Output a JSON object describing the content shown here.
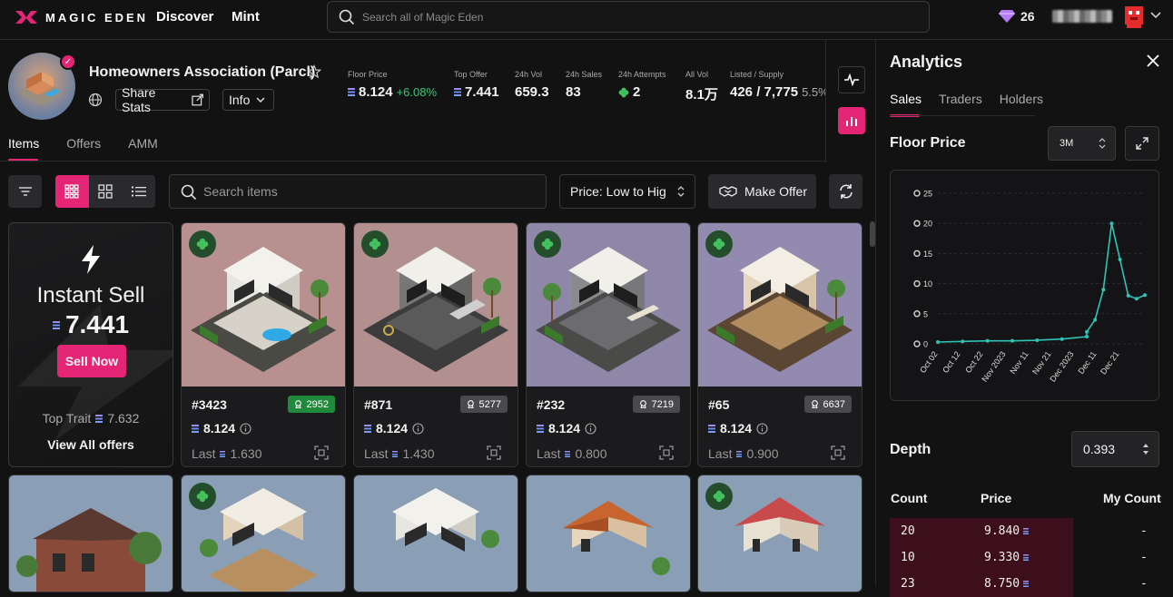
{
  "topbar": {
    "brand": "MAGIC EDEN",
    "nav": [
      "Discover",
      "Mint"
    ],
    "search_placeholder": "Search all of Magic Eden",
    "gem_count": "26"
  },
  "collection": {
    "name": "Homeowners Association (Parcl)",
    "share_label": "Share Stats",
    "info_label": "Info",
    "stats": [
      {
        "label": "Floor Price",
        "value": "8.124",
        "change": "+6.08%",
        "sol": true
      },
      {
        "label": "Top Offer",
        "value": "7.441",
        "sol": true
      },
      {
        "label": "24h Vol",
        "value": "659.3"
      },
      {
        "label": "24h Sales",
        "value": "83"
      },
      {
        "label": "24h Attempts",
        "value": "2",
        "clover": true
      },
      {
        "label": "All Vol",
        "value": "8.1万"
      },
      {
        "label": "Listed / Supply",
        "value": "426 / 7,775",
        "extra": "5.5%"
      }
    ]
  },
  "tabs": [
    "Items",
    "Offers",
    "AMM"
  ],
  "toolbar": {
    "search_placeholder": "Search items",
    "sort_label": "Price: Low to Hig",
    "make_offer_label": "Make Offer"
  },
  "instant_sell": {
    "title": "Instant Sell",
    "price": "7.441",
    "button": "Sell Now",
    "top_trait_label": "Top Trait",
    "top_trait_value": "7.632",
    "view_all": "View All offers"
  },
  "items": [
    {
      "id": "#3423",
      "rank": "2952",
      "rank_color": "green",
      "price": "8.124",
      "last": "1.630",
      "bg": "#b89090"
    },
    {
      "id": "#871",
      "rank": "5277",
      "rank_color": "grey",
      "price": "8.124",
      "last": "1.430",
      "bg": "#b39090"
    },
    {
      "id": "#232",
      "rank": "7219",
      "rank_color": "grey",
      "price": "8.124",
      "last": "0.800",
      "bg": "#8f87a8"
    },
    {
      "id": "#65",
      "rank": "6637",
      "rank_color": "grey",
      "price": "8.124",
      "last": "0.900",
      "bg": "#938ab0"
    }
  ],
  "last_label": "Last",
  "analytics": {
    "title": "Analytics",
    "tabs": [
      "Sales",
      "Traders",
      "Holders"
    ],
    "floor_title": "Floor Price",
    "range": "3M",
    "depth_title": "Depth",
    "depth_value": "0.393",
    "depth_headers": [
      "Count",
      "Price",
      "My Count"
    ],
    "depth_rows": [
      {
        "count": "20",
        "price": "9.840",
        "my": "-",
        "fill": 0.68
      },
      {
        "count": "10",
        "price": "9.330",
        "my": "-",
        "fill": 0.68
      },
      {
        "count": "23",
        "price": "8.750",
        "my": "-",
        "fill": 0.68
      }
    ]
  },
  "chart_data": {
    "type": "scatter",
    "title": "Floor Price",
    "y_ticks": [
      "0",
      "5",
      "10",
      "15",
      "20",
      "25"
    ],
    "ylim": [
      0,
      25
    ],
    "x_labels": [
      "Oct 02",
      "Oct 12",
      "Oct 22",
      "Nov 2023",
      "Nov 11",
      "Nov 21",
      "Dec 2023",
      "Dec 11",
      "Dec 21"
    ],
    "x": [
      "Oct 02",
      "Oct 12",
      "Oct 22",
      "Nov 2023",
      "Nov 11",
      "Nov 21",
      "Dec 2023",
      "Dec 05",
      "Dec 08",
      "Dec 11",
      "Dec 14",
      "Dec 17",
      "Dec 19",
      "Dec 21",
      "Dec 23"
    ],
    "values": [
      0.3,
      0.4,
      0.5,
      0.5,
      0.6,
      0.8,
      1.2,
      2.0,
      4.0,
      9.0,
      20.0,
      14.0,
      8.0,
      7.5,
      8.1
    ],
    "grid": true,
    "point_color": "#2ec4b6"
  }
}
